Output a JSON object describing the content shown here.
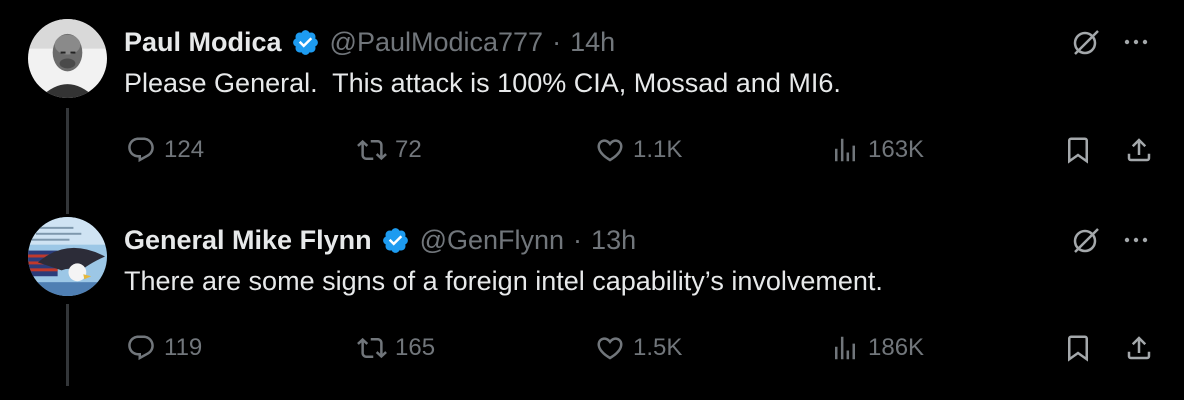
{
  "tweets": [
    {
      "name": "Paul Modica",
      "handle": "@PaulModica777",
      "separator": "·",
      "time": "14h",
      "text": "Please General.  This attack is 100% CIA, Mossad and MI6.",
      "replies": "124",
      "reposts": "72",
      "likes": "1.1K",
      "views": "163K",
      "avatar_icon": "grayscale-portrait-avatar"
    },
    {
      "name": "General Mike Flynn",
      "handle": "@GenFlynn",
      "separator": "·",
      "time": "13h",
      "text": "There are some signs of a foreign intel capability’s involvement.",
      "replies": "119",
      "reposts": "165",
      "likes": "1.5K",
      "views": "186K",
      "avatar_icon": "eagle-flag-avatar"
    }
  ],
  "icons": {
    "verified": "verified-badge-icon",
    "grok": "grok-icon",
    "more": "more-dots-icon",
    "reply": "reply-icon",
    "repost": "repost-icon",
    "like": "heart-icon",
    "views": "views-bar-icon",
    "bookmark": "bookmark-icon",
    "share": "share-icon"
  },
  "colors": {
    "background": "#000000",
    "primary_text": "#e7e9ea",
    "secondary_text": "#71767b",
    "verified_blue": "#1d9bf0",
    "thread_line": "#333639"
  }
}
